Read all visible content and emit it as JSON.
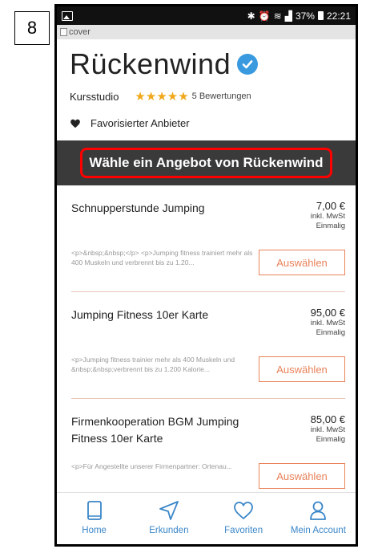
{
  "step_badge": "8",
  "status_bar": {
    "battery": "37%",
    "time": "22:21"
  },
  "cover_alt": "cover",
  "provider": {
    "name": "Rückenwind",
    "category": "Kursstudio",
    "rating": 5,
    "stars": "★★★★★",
    "reviews": "5 Bewertungen",
    "favorite_label": "Favorisierter Anbieter"
  },
  "offer_header": "Wähle ein Angebot von Rückenwind",
  "offers": [
    {
      "name": "Schnupperstunde Jumping",
      "price": "7,00 €",
      "tax": "inkl. MwSt",
      "frequency": "Einmalig",
      "description": "<p>&nbsp;&nbsp;</p> <p>Jumping fitness trainiert mehr als 400 Muskeln und verbrennt bis zu 1.20...",
      "button": "Auswählen"
    },
    {
      "name": "Jumping Fitness 10er Karte",
      "price": "95,00 €",
      "tax": "inkl. MwSt",
      "frequency": "Einmalig",
      "description": "<p>Jumping fitness trainier mehr als 400 Muskeln und &nbsp;&nbsp;verbrennt bis zu 1.200 Kalorie...",
      "button": "Auswählen"
    },
    {
      "name": "Firmenkooperation BGM Jumping Fitness 10er Karte",
      "price": "85,00 €",
      "tax": "inkl. MwSt",
      "frequency": "Einmalig",
      "description": "<p>Für Angestellte unserer Firmenpartner: Ortenau...",
      "button": "Auswählen"
    }
  ],
  "nav": [
    {
      "label": "Home",
      "icon": "tablet-icon"
    },
    {
      "label": "Erkunden",
      "icon": "navigation-arrow-icon"
    },
    {
      "label": "Favoriten",
      "icon": "heart-outline-icon"
    },
    {
      "label": "Mein Account",
      "icon": "person-icon"
    }
  ],
  "colors": {
    "accent_blue": "#3a86c8",
    "button_orange": "#e8825a",
    "highlight_red": "#ff0000",
    "header_dark": "#3a3a3a",
    "star_gold": "#f0a81a"
  }
}
